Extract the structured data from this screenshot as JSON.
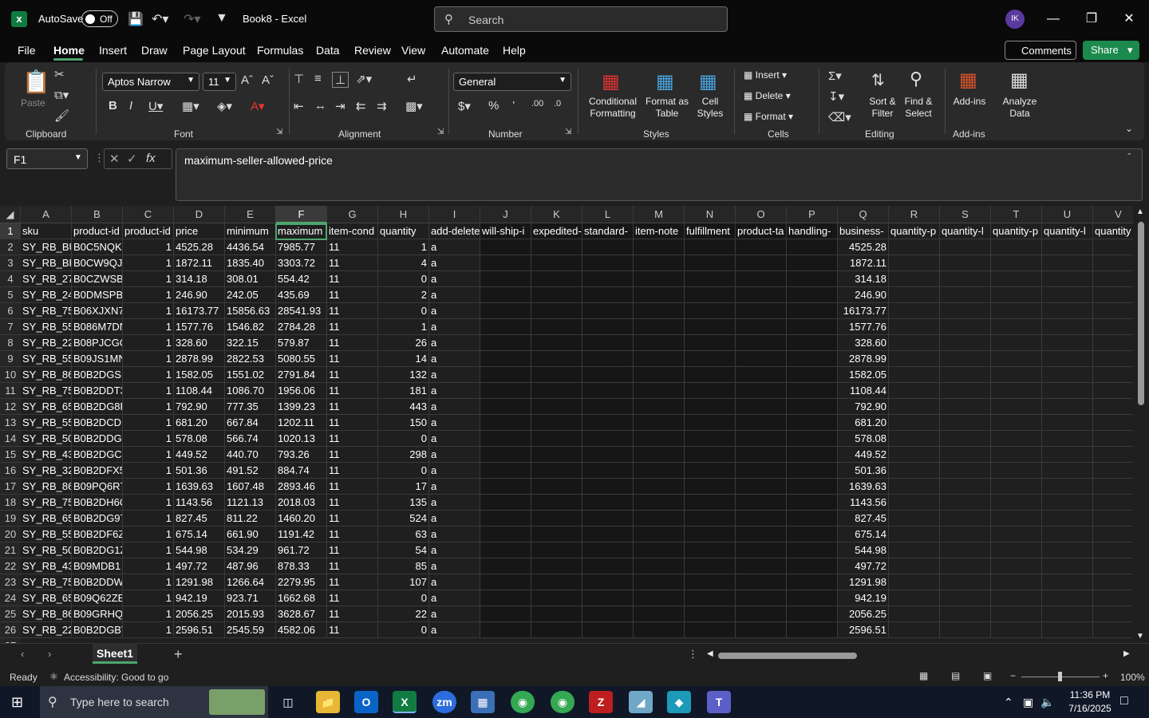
{
  "app": {
    "autosave_label": "AutoSave",
    "autosave_state": "Off",
    "doc_title": "Book8  -  Excel",
    "search_placeholder": "Search",
    "avatar_initials": "IK"
  },
  "menu": [
    "File",
    "Home",
    "Insert",
    "Draw",
    "Page Layout",
    "Formulas",
    "Data",
    "Review",
    "View",
    "Automate",
    "Help"
  ],
  "top_buttons": {
    "comments": "Comments",
    "share": "Share"
  },
  "ribbon": {
    "clipboard": {
      "label": "Clipboard",
      "paste": "Paste"
    },
    "font": {
      "label": "Font",
      "font_name": "Aptos Narrow",
      "font_size": "11"
    },
    "alignment": {
      "label": "Alignment"
    },
    "number": {
      "label": "Number",
      "format": "General"
    },
    "styles": {
      "label": "Styles",
      "conditional": [
        "Conditional",
        "Formatting"
      ],
      "format_table": [
        "Format as",
        "Table"
      ],
      "cell_styles": [
        "Cell",
        "Styles"
      ]
    },
    "cells": {
      "label": "Cells",
      "insert": "Insert",
      "delete": "Delete",
      "format": "Format"
    },
    "editing": {
      "label": "Editing",
      "sort": [
        "Sort &",
        "Filter"
      ],
      "find": [
        "Find &",
        "Select"
      ]
    },
    "addins": {
      "label": "Add-ins",
      "addins": "Add-ins",
      "analyze": [
        "Analyze",
        "Data"
      ]
    }
  },
  "formula_bar": {
    "name_box": "F1",
    "formula": "maximum-seller-allowed-price"
  },
  "columns": [
    "A",
    "B",
    "C",
    "D",
    "E",
    "F",
    "G",
    "H",
    "I",
    "J",
    "K",
    "L",
    "M",
    "N",
    "O",
    "P",
    "Q",
    "R",
    "S",
    "T",
    "U",
    "V"
  ],
  "header_row": [
    "sku",
    "product-id",
    "product-id",
    "price",
    "minimum",
    "maximum",
    "item-cond",
    "quantity",
    "add-delete",
    "will-ship-i",
    "expedited-",
    "standard-",
    "item-note",
    "fulfillment",
    "product-ta",
    "handling-",
    "business-",
    "quantity-p",
    "quantity-l",
    "quantity-p",
    "quantity-l",
    "quantity"
  ],
  "rows": [
    [
      "SY_RB_BU",
      "B0C5NQKI",
      "1",
      "4525.28",
      "4436.54",
      "7985.77",
      "11",
      "1",
      "a",
      "4525.28"
    ],
    [
      "SY_RB_BF",
      "B0CW9QJ6",
      "1",
      "1872.11",
      "1835.40",
      "3303.72",
      "11",
      "4",
      "a",
      "1872.11"
    ],
    [
      "SY_RB_27",
      "B0CZWSB1",
      "1",
      "314.18",
      "308.01",
      "554.42",
      "11",
      "0",
      "a",
      "314.18"
    ],
    [
      "SY_RB_24",
      "B0DMSPB",
      "1",
      "246.90",
      "242.05",
      "435.69",
      "11",
      "2",
      "a",
      "246.90"
    ],
    [
      "SY_RB_75",
      "B06XJXN7",
      "1",
      "16173.77",
      "15856.63",
      "28541.93",
      "11",
      "0",
      "a",
      "16173.77"
    ],
    [
      "SY_RB_55",
      "B086M7DN",
      "1",
      "1577.76",
      "1546.82",
      "2784.28",
      "11",
      "1",
      "a",
      "1577.76"
    ],
    [
      "SY_RB_22",
      "B08PJCGQ",
      "1",
      "328.60",
      "322.15",
      "579.87",
      "11",
      "26",
      "a",
      "328.60"
    ],
    [
      "SY_RB_55",
      "B09JS1MN",
      "1",
      "2878.99",
      "2822.53",
      "5080.55",
      "11",
      "14",
      "a",
      "2878.99"
    ],
    [
      "SY_RB_86",
      "B0B2DGSF",
      "1",
      "1582.05",
      "1551.02",
      "2791.84",
      "11",
      "132",
      "a",
      "1582.05"
    ],
    [
      "SY_RB_75",
      "B0B2DDT3",
      "1",
      "1108.44",
      "1086.70",
      "1956.06",
      "11",
      "181",
      "a",
      "1108.44"
    ],
    [
      "SY_RB_65",
      "B0B2DG8F",
      "1",
      "792.90",
      "777.35",
      "1399.23",
      "11",
      "443",
      "a",
      "792.90"
    ],
    [
      "SY_RB_55",
      "B0B2DCDK",
      "1",
      "681.20",
      "667.84",
      "1202.11",
      "11",
      "150",
      "a",
      "681.20"
    ],
    [
      "SY_RB_50",
      "B0B2DDG1",
      "1",
      "578.08",
      "566.74",
      "1020.13",
      "11",
      "0",
      "a",
      "578.08"
    ],
    [
      "SY_RB_43",
      "B0B2DGCF",
      "1",
      "449.52",
      "440.70",
      "793.26",
      "11",
      "298",
      "a",
      "449.52"
    ],
    [
      "SY_RB_32",
      "B0B2DFX5",
      "1",
      "501.36",
      "491.52",
      "884.74",
      "11",
      "0",
      "a",
      "501.36"
    ],
    [
      "SY_RB_86",
      "B09PQ6R7",
      "1",
      "1639.63",
      "1607.48",
      "2893.46",
      "11",
      "17",
      "a",
      "1639.63"
    ],
    [
      "SY_RB_75",
      "B0B2DH6C",
      "1",
      "1143.56",
      "1121.13",
      "2018.03",
      "11",
      "135",
      "a",
      "1143.56"
    ],
    [
      "SY_RB_65",
      "B0B2DG97",
      "1",
      "827.45",
      "811.22",
      "1460.20",
      "11",
      "524",
      "a",
      "827.45"
    ],
    [
      "SY_RB_55",
      "B0B2DF6Z",
      "1",
      "675.14",
      "661.90",
      "1191.42",
      "11",
      "63",
      "a",
      "675.14"
    ],
    [
      "SY_RB_50",
      "B0B2DG1Z",
      "1",
      "544.98",
      "534.29",
      "961.72",
      "11",
      "54",
      "a",
      "544.98"
    ],
    [
      "SY_RB_43",
      "B09MDB1",
      "1",
      "497.72",
      "487.96",
      "878.33",
      "11",
      "85",
      "a",
      "497.72"
    ],
    [
      "SY_RB_75",
      "B0B2DDW",
      "1",
      "1291.98",
      "1266.64",
      "2279.95",
      "11",
      "107",
      "a",
      "1291.98"
    ],
    [
      "SY_RB_65",
      "B09Q62ZB",
      "1",
      "942.19",
      "923.71",
      "1662.68",
      "11",
      "0",
      "a",
      "942.19"
    ],
    [
      "SY_RB_86",
      "B09GRHQI",
      "1",
      "2056.25",
      "2015.93",
      "3628.67",
      "11",
      "22",
      "a",
      "2056.25"
    ],
    [
      "SY_RB_22",
      "B0B2DGBV",
      "1",
      "2596.51",
      "2545.59",
      "4582.06",
      "11",
      "0",
      "a",
      "2596.51"
    ]
  ],
  "sheet_tabs": [
    "Sheet1"
  ],
  "status": {
    "ready": "Ready",
    "accessibility": "Accessibility: Good to go",
    "zoom": "100%"
  },
  "taskbar": {
    "search_placeholder": "Type here to search",
    "time": "11:36 PM",
    "date": "7/16/2025"
  },
  "colors": {
    "accent_green": "#1b8a4c",
    "selection": "#4ea56e",
    "excel": "#107c41"
  }
}
